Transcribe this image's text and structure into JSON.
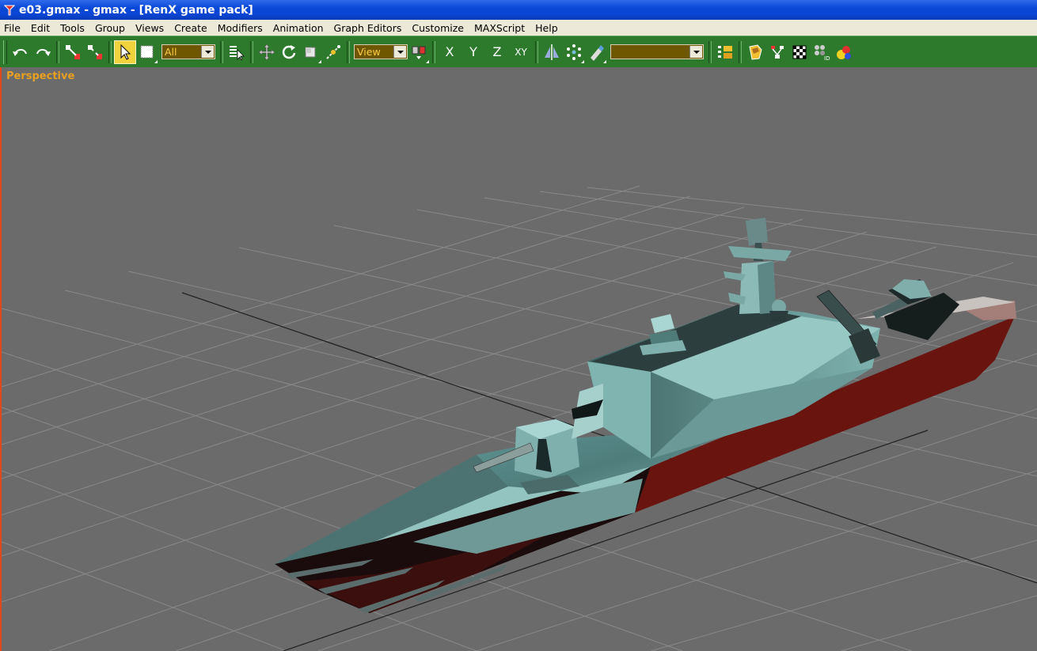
{
  "window": {
    "title": "e03.gmax - gmax - [RenX game pack]"
  },
  "menubar": {
    "items": [
      "File",
      "Edit",
      "Tools",
      "Group",
      "Views",
      "Create",
      "Modifiers",
      "Animation",
      "Graph Editors",
      "Customize",
      "MAXScript",
      "Help"
    ]
  },
  "toolbar": {
    "selection_filter": "All",
    "reference_coord": "View",
    "axis_x": "X",
    "axis_y": "Y",
    "axis_z": "Z",
    "axis_xy": "XY",
    "named_selection": ""
  },
  "viewport": {
    "label": "Perspective"
  },
  "colors": {
    "title_blue": "#0a48d8",
    "toolbar_green": "#2d7a2d",
    "viewport_gray": "#6b6b6b",
    "label_orange": "#e8a020",
    "active_border": "#e0481c",
    "hull_red": "#6a1410",
    "ship_teal": "#6c9c9a"
  }
}
